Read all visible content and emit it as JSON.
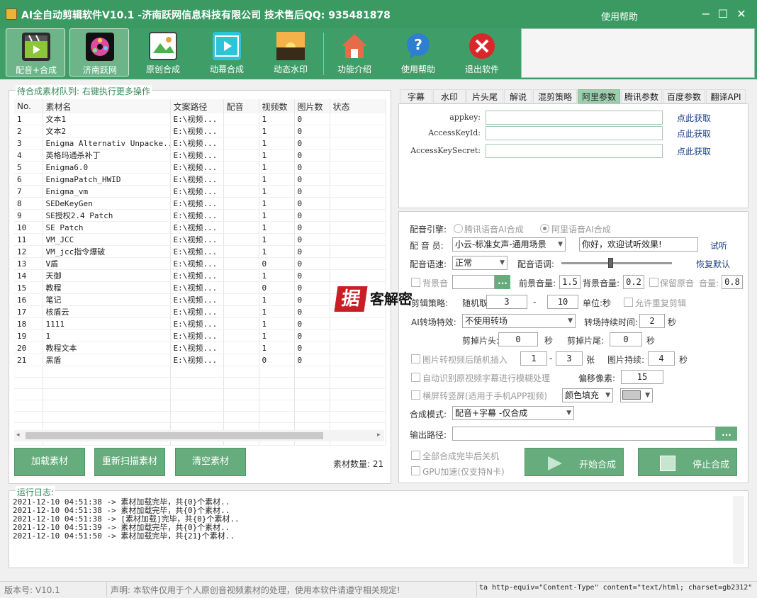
{
  "window": {
    "title": "AI全自动剪辑软件V10.1 -济南跃网信息科技有限公司 技术售后QQ: 935481878",
    "help_menu": "使用帮助"
  },
  "toolbar": {
    "buttons": [
      {
        "label": "配音+合成",
        "icon": "film-clapper-icon"
      },
      {
        "label": "济南跃网",
        "icon": "film-reel-icon"
      },
      {
        "label": "原创合成",
        "icon": "image-edit-icon"
      },
      {
        "label": "动幕合成",
        "icon": "video-play-icon"
      },
      {
        "label": "动态水印",
        "icon": "sunset-image-icon"
      },
      {
        "label": "功能介绍",
        "icon": "home-icon"
      },
      {
        "label": "使用帮助",
        "icon": "help-icon"
      },
      {
        "label": "退出软件",
        "icon": "exit-icon"
      }
    ]
  },
  "queue": {
    "title": "待合成素材队列: 右键执行更多操作",
    "columns": [
      "No.",
      "素材名",
      "文案路径",
      "配音",
      "视频数",
      "图片数",
      "状态"
    ],
    "rows": [
      [
        "1",
        "文本1",
        "E:\\视频...",
        "",
        "1",
        "0",
        ""
      ],
      [
        "2",
        "文本2",
        "E:\\视频...",
        "",
        "1",
        "0",
        ""
      ],
      [
        "3",
        "Enigma Alternativ Unpacke...",
        "E:\\视频...",
        "",
        "1",
        "0",
        ""
      ],
      [
        "4",
        "英格玛通杀补丁",
        "E:\\视频...",
        "",
        "1",
        "0",
        ""
      ],
      [
        "5",
        "Enigma6.0",
        "E:\\视频...",
        "",
        "1",
        "0",
        ""
      ],
      [
        "6",
        "EnigmaPatch_HWID",
        "E:\\视频...",
        "",
        "1",
        "0",
        ""
      ],
      [
        "7",
        "Enigma_vm",
        "E:\\视频...",
        "",
        "1",
        "0",
        ""
      ],
      [
        "8",
        "SEDeKeyGen",
        "E:\\视频...",
        "",
        "1",
        "0",
        ""
      ],
      [
        "9",
        "SE授权2.4 Patch",
        "E:\\视频...",
        "",
        "1",
        "0",
        ""
      ],
      [
        "10",
        "SE Patch",
        "E:\\视频...",
        "",
        "1",
        "0",
        ""
      ],
      [
        "11",
        "VM_JCC",
        "E:\\视频...",
        "",
        "1",
        "0",
        ""
      ],
      [
        "12",
        "VM_jcc指令爆破",
        "E:\\视频...",
        "",
        "1",
        "0",
        ""
      ],
      [
        "13",
        "V盾",
        "E:\\视频...",
        "",
        "0",
        "0",
        ""
      ],
      [
        "14",
        "天御",
        "E:\\视频...",
        "",
        "1",
        "0",
        ""
      ],
      [
        "15",
        "教程",
        "E:\\视频...",
        "",
        "0",
        "0",
        ""
      ],
      [
        "16",
        "笔记",
        "E:\\视频...",
        "",
        "1",
        "0",
        ""
      ],
      [
        "17",
        "核盾云",
        "E:\\视频...",
        "",
        "1",
        "0",
        ""
      ],
      [
        "18",
        "1111",
        "E:\\视频...",
        "",
        "1",
        "0",
        ""
      ],
      [
        "19",
        "1",
        "E:\\视频...",
        "",
        "1",
        "0",
        ""
      ],
      [
        "20",
        "教程文本",
        "E:\\视频...",
        "",
        "1",
        "0",
        ""
      ],
      [
        "21",
        "黑盾",
        "E:\\视频...",
        "",
        "0",
        "0",
        ""
      ]
    ],
    "load_button": "加载素材",
    "rescan_button": "重新扫描素材",
    "clear_button": "清空素材",
    "count_text": "素材数量: 21"
  },
  "tabs": [
    "字幕",
    "水印",
    "片头尾",
    "解说",
    "混剪策略",
    "阿里参数",
    "腾讯参数",
    "百度参数",
    "翻译API"
  ],
  "active_tab": "阿里参数",
  "ali": {
    "fields": [
      {
        "label": "appkey:",
        "value": "",
        "link": "点此获取"
      },
      {
        "label": "AccessKeyId:",
        "value": "",
        "link": "点此获取"
      },
      {
        "label": "AccessKeySecret:",
        "value": "",
        "link": "点此获取"
      }
    ]
  },
  "settings": {
    "engine_label": "配音引擎:",
    "engine_tencent": "腾讯语音AI合成",
    "engine_ali": "阿里语音AI合成",
    "voice_label": "配 音 员:",
    "voice_value": "小云-标准女声-通用场景",
    "test_text": "你好，欢迎试听效果!",
    "test_link": "试听",
    "speed_label": "配音语速:",
    "speed_value": "正常",
    "pitch_label": "配音语调:",
    "pitch_level": 0.45,
    "restore_link": "恢复默认",
    "bgm_label": "背景音",
    "bgm_value": "",
    "dots": "...",
    "fg_vol_label": "前景音量:",
    "fg_vol": "1.5",
    "bg_vol_label": "背景音量:",
    "bg_vol": "0.2",
    "keep_orig_label": "保留原音",
    "vol_label": "音量:",
    "vol": "0.8",
    "cut_label": "剪辑策略:",
    "random_label": "随机取:",
    "cut_min": "3",
    "dash": "-",
    "cut_max": "10",
    "unit_label": "单位:秒",
    "allow_repeat_label": "允许重复剪辑",
    "transition_label": "AI转场特效:",
    "transition_value": "不使用转场",
    "transition_dur_label": "转场持续时间:",
    "transition_dur": "2",
    "sec": "秒",
    "cut_head_label": "剪掉片头:",
    "cut_head": "0",
    "cut_tail_label": "剪掉片尾:",
    "cut_tail": "0",
    "img_insert_label": "图片转视频后随机插入",
    "img_min": "1",
    "img_max": "3",
    "img_unit": "张",
    "img_dur_label": "图片持续:",
    "img_dur": "4",
    "blur_label": "自动识别原视频字幕进行模糊处理",
    "offset_label": "偏移像素:",
    "offset": "15",
    "vertical_label": "横屏转竖屏(适用于手机APP视频)",
    "fill_value": "颜色填充",
    "mode_label": "合成模式:",
    "mode_value": "配音+字幕 -仅合成",
    "output_label": "输出路径:",
    "output_value": "",
    "shutdown_label": "全部合成完毕后关机",
    "gpu_label": "GPU加速(仅支持N卡)",
    "start_button": "开始合成",
    "stop_button": "停止合成"
  },
  "log": {
    "title": "运行日志:",
    "lines": [
      "2021-12-10 04:51:38 -> 素材加载完毕，共{0}个素材..",
      "2021-12-10 04:51:38 -> 素材加载完毕，共{0}个素材..",
      "2021-12-10 04:51:38 -> [素材加载]完毕，共{0}个素材..",
      "2021-12-10 04:51:39 -> 素材加载完毕，共{0}个素材..",
      "2021-12-10 04:51:50 -> 素材加载完毕，共{21}个素材.."
    ]
  },
  "status": {
    "version": "版本号: V10.1",
    "notice": "声明: 本软件仅用于个人原创音视频素材的处理，使用本软件请遵守相关规定!",
    "meta": "ta http-equiv=\"Content-Type\" content=\"text/html; charset=gb2312\""
  },
  "watermark": {
    "text": "客解密",
    "badge": "据"
  },
  "colors": {
    "accent": "#3f9e68",
    "button": "#67ac7c",
    "link": "#1b3f8b"
  }
}
